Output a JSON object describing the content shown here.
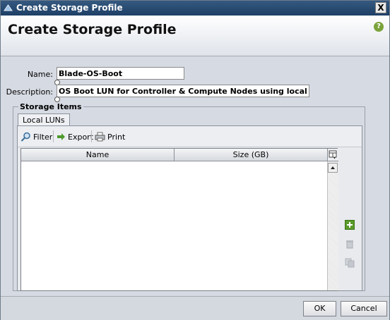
{
  "window": {
    "title": "Create Storage Profile",
    "close_label": "X"
  },
  "header": {
    "heading": "Create Storage Profile",
    "help_label": "?"
  },
  "form": {
    "name_label": "Name:",
    "name_value": "Blade-OS-Boot",
    "description_label": "Description:",
    "description_value": "OS Boot LUN for Controller & Compute Nodes using local disk"
  },
  "storage_items": {
    "group_label": "Storage Items",
    "tabs": [
      {
        "label": "Local LUNs"
      }
    ],
    "toolbar": {
      "filter": "Filter",
      "export": "Export",
      "print": "Print"
    },
    "columns": [
      {
        "label": "Name"
      },
      {
        "label": "Size (GB)"
      }
    ],
    "rows": []
  },
  "footer": {
    "ok_label": "OK",
    "cancel_label": "Cancel"
  },
  "colors": {
    "titlebar": "#1e3f66",
    "add_green": "#5a9a2a",
    "help_green": "#7ba33b"
  }
}
